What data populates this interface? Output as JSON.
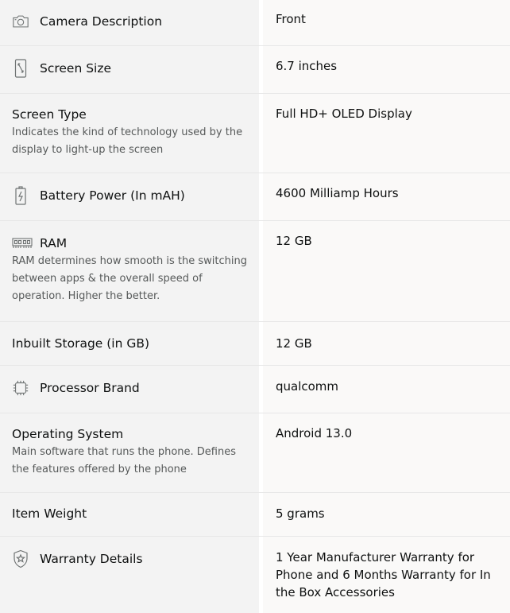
{
  "rows": [
    {
      "label": "Camera Description",
      "icon": "camera-icon",
      "value": "Front"
    },
    {
      "label": "Screen Size",
      "icon": "screen-size-icon",
      "value": "6.7 inches"
    },
    {
      "label": "Screen Type",
      "desc": "Indicates the kind of technology used by the display to light-up the screen",
      "value": "Full HD+ OLED Display"
    },
    {
      "label": "Battery Power (In mAH)",
      "icon": "battery-icon",
      "value": "4600 Milliamp Hours"
    },
    {
      "label": "RAM",
      "icon": "ram-icon",
      "desc": "RAM determines how smooth is the switching between apps & the overall speed of operation. Higher the better.",
      "value": "12 GB"
    },
    {
      "label": "Inbuilt Storage (in GB)",
      "value": "12 GB"
    },
    {
      "label": "Processor Brand",
      "icon": "processor-icon",
      "value": "qualcomm"
    },
    {
      "label": "Operating System",
      "desc": "Main software that runs the phone. Defines the features offered by the phone",
      "value": "Android 13.0"
    },
    {
      "label": "Item Weight",
      "value": "5 grams"
    },
    {
      "label": "Warranty Details",
      "icon": "warranty-icon",
      "value": "1 Year Manufacturer Warranty for Phone and 6 Months Warranty for In the Box Accessories"
    }
  ]
}
